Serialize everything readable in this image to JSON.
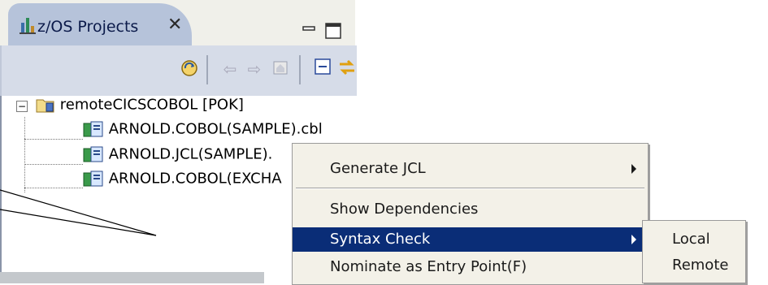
{
  "view": {
    "tab_title": "z/OS Projects",
    "close_glyph": "✕"
  },
  "toolbar": {
    "icons": [
      "refresh-icon",
      "back-arrow-icon",
      "forward-arrow-icon",
      "home-icon",
      "collapse-all-icon",
      "link-editor-icon",
      "view-menu-icon"
    ]
  },
  "tree": {
    "project": "remoteCICSCOBOL  [POK]",
    "files": [
      "ARNOLD.COBOL(SAMPLE).cbl",
      "ARNOLD.JCL(SAMPLE).",
      "ARNOLD.COBOL(EXCHA"
    ]
  },
  "context_menu": {
    "items": [
      {
        "label": "Generate JCL",
        "has_submenu": true
      },
      {
        "label": "Show Dependencies",
        "has_submenu": false
      },
      {
        "label": "Syntax Check",
        "has_submenu": true,
        "selected": true
      },
      {
        "label": "Nominate as Entry Point(F)",
        "has_submenu": false
      }
    ]
  },
  "submenu": {
    "items": [
      "Local",
      "Remote"
    ]
  },
  "colors": {
    "tab_active": "#b6c3da",
    "menu_bg": "#f3f1e8",
    "selection": "#0a2d77",
    "toolbar_bg": "#d6dce8"
  }
}
